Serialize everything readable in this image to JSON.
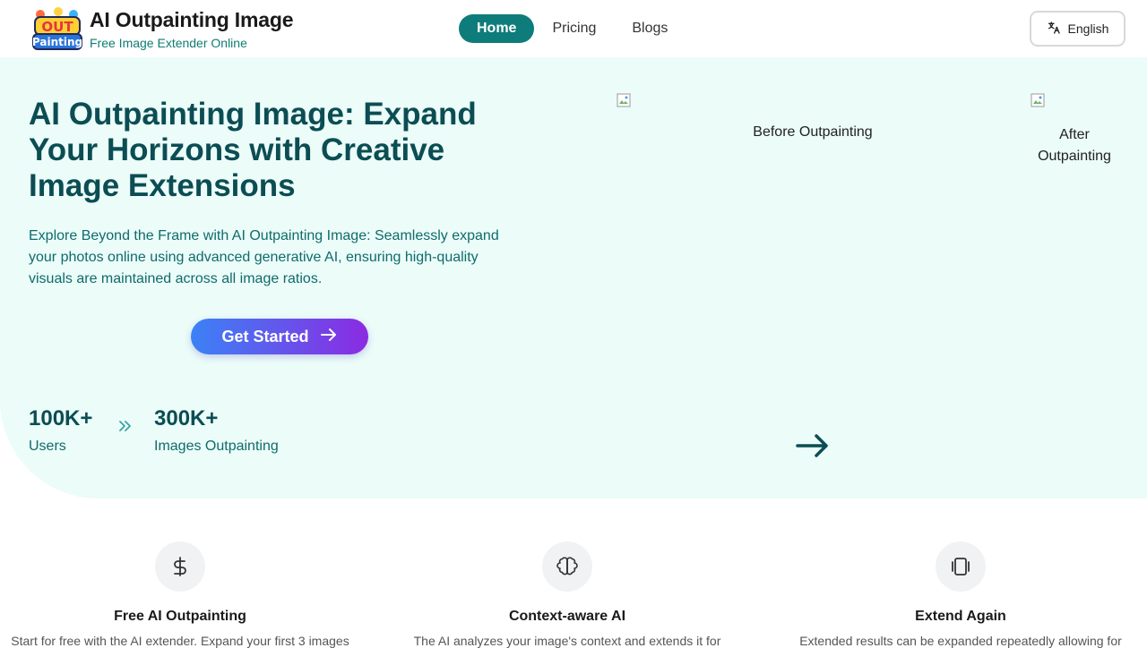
{
  "header": {
    "brand_title": "AI Outpainting Image",
    "brand_subtitle": "Free Image Extender Online",
    "logo_text_top": "OUT",
    "logo_text_bottom": "Painting",
    "nav": [
      {
        "label": "Home",
        "active": true
      },
      {
        "label": "Pricing",
        "active": false
      },
      {
        "label": "Blogs",
        "active": false
      }
    ],
    "language": "English",
    "language_icon": "translate-icon"
  },
  "hero": {
    "title": "AI Outpainting Image: Expand Your Horizons with Creative Image Extensions",
    "description": "Explore Beyond the Frame with AI Outpainting Image: Seamlessly expand your photos online using advanced generative AI, ensuring high-quality visuals are maintained across all image ratios.",
    "cta_label": "Get Started",
    "stats": [
      {
        "value": "100K+",
        "label": "Users"
      },
      {
        "value": "300K+",
        "label": "Images Outpainting"
      }
    ],
    "before_caption": "Before Outpainting",
    "after_caption_line1": "After",
    "after_caption_line2": "Outpainting"
  },
  "features": [
    {
      "icon": "dollar-icon",
      "title": "Free AI Outpainting",
      "desc": "Start for free with the AI extender. Expand your first 3 images"
    },
    {
      "icon": "brain-icon",
      "title": "Context-aware AI",
      "desc": "The AI analyzes your image's context and extends it for"
    },
    {
      "icon": "frame-icon",
      "title": "Extend Again",
      "desc": "Extended results can be expanded repeatedly allowing for"
    }
  ],
  "colors": {
    "accent": "#0e7c7b",
    "hero_bg": "#ebfcf9",
    "title": "#0b4d53",
    "gradient_start": "#3b82f6",
    "gradient_end": "#8b2be2"
  }
}
